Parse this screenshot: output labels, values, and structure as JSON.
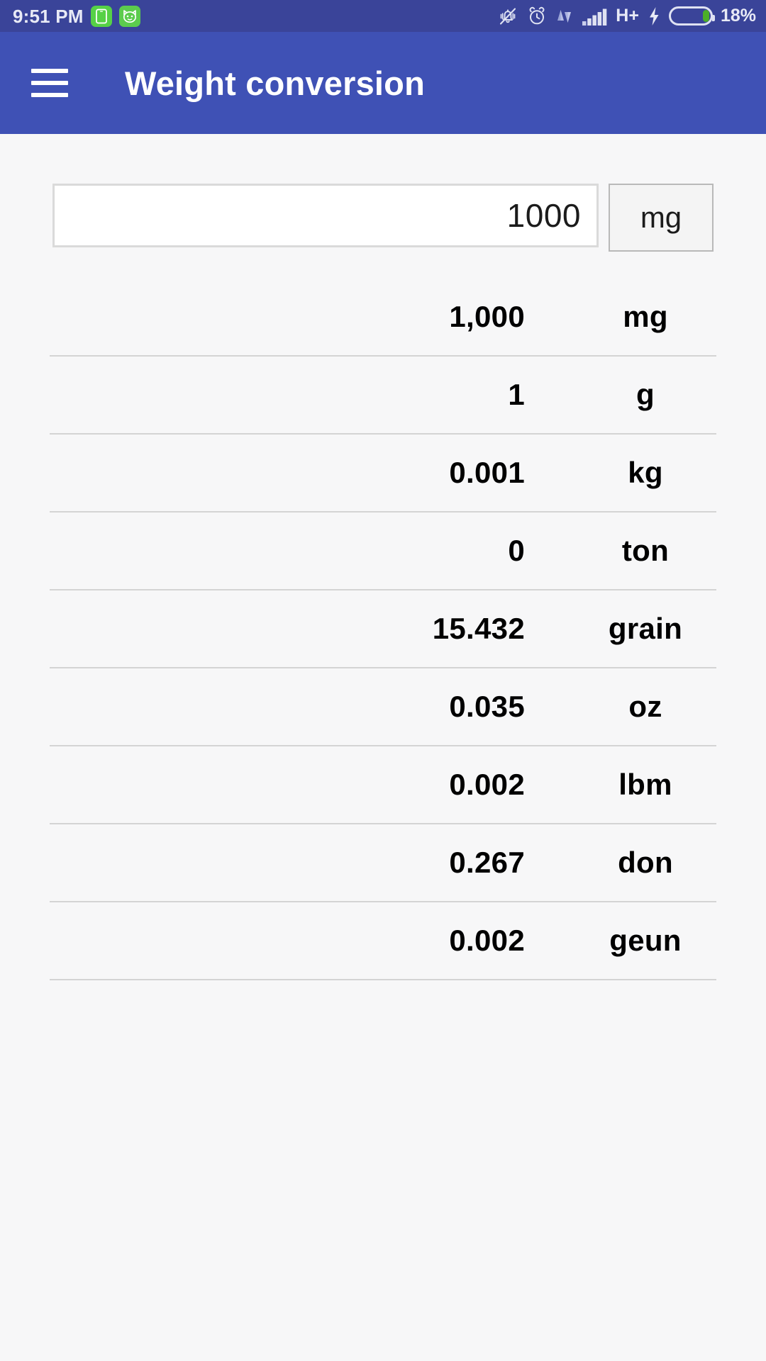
{
  "status_bar": {
    "time": "9:51 PM",
    "network_type": "H+",
    "battery_percent": "18%",
    "battery_level": 18,
    "icons": {
      "app_icon_1": "phone-app-icon",
      "app_icon_2": "cat-face-app-icon",
      "mute": "bell-muted-icon",
      "alarm": "alarm-clock-icon",
      "data": "data-transfer-icon",
      "signal": "signal-bars-icon",
      "charging": "lightning-bolt-icon",
      "battery": "battery-icon"
    },
    "background_color": "#3a4499"
  },
  "app_bar": {
    "menu_icon": "hamburger-menu-icon",
    "title": "Weight conversion",
    "background_color": "#3f51b5"
  },
  "input": {
    "value": "1000",
    "placeholder": "0",
    "unit": "mg"
  },
  "conversions": [
    {
      "value": "1,000",
      "unit": "mg"
    },
    {
      "value": "1",
      "unit": "g"
    },
    {
      "value": "0.001",
      "unit": "kg"
    },
    {
      "value": "0",
      "unit": "ton"
    },
    {
      "value": "15.432",
      "unit": "grain"
    },
    {
      "value": "0.035",
      "unit": "oz"
    },
    {
      "value": "0.002",
      "unit": "lbm"
    },
    {
      "value": "0.267",
      "unit": "don"
    },
    {
      "value": "0.002",
      "unit": "geun"
    }
  ]
}
